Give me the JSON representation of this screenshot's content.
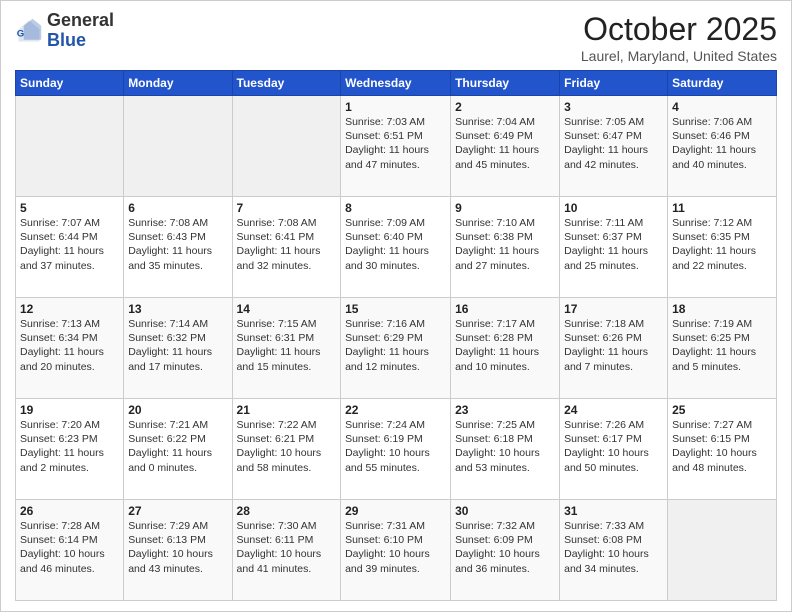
{
  "header": {
    "logo_general": "General",
    "logo_blue": "Blue",
    "month_title": "October 2025",
    "location": "Laurel, Maryland, United States"
  },
  "days_of_week": [
    "Sunday",
    "Monday",
    "Tuesday",
    "Wednesday",
    "Thursday",
    "Friday",
    "Saturday"
  ],
  "weeks": [
    [
      {
        "day": "",
        "info": ""
      },
      {
        "day": "",
        "info": ""
      },
      {
        "day": "",
        "info": ""
      },
      {
        "day": "1",
        "info": "Sunrise: 7:03 AM\nSunset: 6:51 PM\nDaylight: 11 hours\nand 47 minutes."
      },
      {
        "day": "2",
        "info": "Sunrise: 7:04 AM\nSunset: 6:49 PM\nDaylight: 11 hours\nand 45 minutes."
      },
      {
        "day": "3",
        "info": "Sunrise: 7:05 AM\nSunset: 6:47 PM\nDaylight: 11 hours\nand 42 minutes."
      },
      {
        "day": "4",
        "info": "Sunrise: 7:06 AM\nSunset: 6:46 PM\nDaylight: 11 hours\nand 40 minutes."
      }
    ],
    [
      {
        "day": "5",
        "info": "Sunrise: 7:07 AM\nSunset: 6:44 PM\nDaylight: 11 hours\nand 37 minutes."
      },
      {
        "day": "6",
        "info": "Sunrise: 7:08 AM\nSunset: 6:43 PM\nDaylight: 11 hours\nand 35 minutes."
      },
      {
        "day": "7",
        "info": "Sunrise: 7:08 AM\nSunset: 6:41 PM\nDaylight: 11 hours\nand 32 minutes."
      },
      {
        "day": "8",
        "info": "Sunrise: 7:09 AM\nSunset: 6:40 PM\nDaylight: 11 hours\nand 30 minutes."
      },
      {
        "day": "9",
        "info": "Sunrise: 7:10 AM\nSunset: 6:38 PM\nDaylight: 11 hours\nand 27 minutes."
      },
      {
        "day": "10",
        "info": "Sunrise: 7:11 AM\nSunset: 6:37 PM\nDaylight: 11 hours\nand 25 minutes."
      },
      {
        "day": "11",
        "info": "Sunrise: 7:12 AM\nSunset: 6:35 PM\nDaylight: 11 hours\nand 22 minutes."
      }
    ],
    [
      {
        "day": "12",
        "info": "Sunrise: 7:13 AM\nSunset: 6:34 PM\nDaylight: 11 hours\nand 20 minutes."
      },
      {
        "day": "13",
        "info": "Sunrise: 7:14 AM\nSunset: 6:32 PM\nDaylight: 11 hours\nand 17 minutes."
      },
      {
        "day": "14",
        "info": "Sunrise: 7:15 AM\nSunset: 6:31 PM\nDaylight: 11 hours\nand 15 minutes."
      },
      {
        "day": "15",
        "info": "Sunrise: 7:16 AM\nSunset: 6:29 PM\nDaylight: 11 hours\nand 12 minutes."
      },
      {
        "day": "16",
        "info": "Sunrise: 7:17 AM\nSunset: 6:28 PM\nDaylight: 11 hours\nand 10 minutes."
      },
      {
        "day": "17",
        "info": "Sunrise: 7:18 AM\nSunset: 6:26 PM\nDaylight: 11 hours\nand 7 minutes."
      },
      {
        "day": "18",
        "info": "Sunrise: 7:19 AM\nSunset: 6:25 PM\nDaylight: 11 hours\nand 5 minutes."
      }
    ],
    [
      {
        "day": "19",
        "info": "Sunrise: 7:20 AM\nSunset: 6:23 PM\nDaylight: 11 hours\nand 2 minutes."
      },
      {
        "day": "20",
        "info": "Sunrise: 7:21 AM\nSunset: 6:22 PM\nDaylight: 11 hours\nand 0 minutes."
      },
      {
        "day": "21",
        "info": "Sunrise: 7:22 AM\nSunset: 6:21 PM\nDaylight: 10 hours\nand 58 minutes."
      },
      {
        "day": "22",
        "info": "Sunrise: 7:24 AM\nSunset: 6:19 PM\nDaylight: 10 hours\nand 55 minutes."
      },
      {
        "day": "23",
        "info": "Sunrise: 7:25 AM\nSunset: 6:18 PM\nDaylight: 10 hours\nand 53 minutes."
      },
      {
        "day": "24",
        "info": "Sunrise: 7:26 AM\nSunset: 6:17 PM\nDaylight: 10 hours\nand 50 minutes."
      },
      {
        "day": "25",
        "info": "Sunrise: 7:27 AM\nSunset: 6:15 PM\nDaylight: 10 hours\nand 48 minutes."
      }
    ],
    [
      {
        "day": "26",
        "info": "Sunrise: 7:28 AM\nSunset: 6:14 PM\nDaylight: 10 hours\nand 46 minutes."
      },
      {
        "day": "27",
        "info": "Sunrise: 7:29 AM\nSunset: 6:13 PM\nDaylight: 10 hours\nand 43 minutes."
      },
      {
        "day": "28",
        "info": "Sunrise: 7:30 AM\nSunset: 6:11 PM\nDaylight: 10 hours\nand 41 minutes."
      },
      {
        "day": "29",
        "info": "Sunrise: 7:31 AM\nSunset: 6:10 PM\nDaylight: 10 hours\nand 39 minutes."
      },
      {
        "day": "30",
        "info": "Sunrise: 7:32 AM\nSunset: 6:09 PM\nDaylight: 10 hours\nand 36 minutes."
      },
      {
        "day": "31",
        "info": "Sunrise: 7:33 AM\nSunset: 6:08 PM\nDaylight: 10 hours\nand 34 minutes."
      },
      {
        "day": "",
        "info": ""
      }
    ]
  ]
}
